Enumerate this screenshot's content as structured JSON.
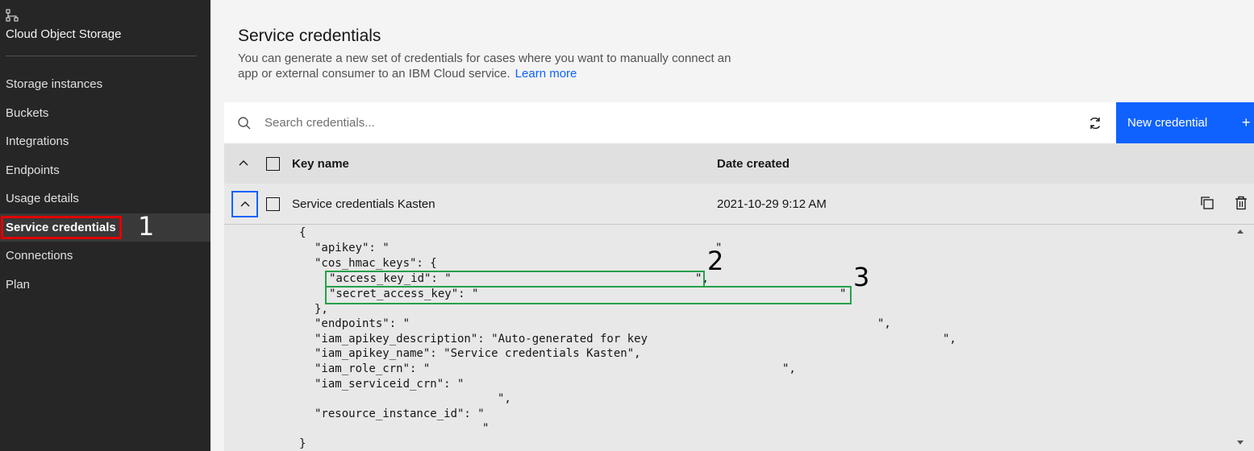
{
  "sidebar": {
    "icon": "hierarchy-icon",
    "title": "Cloud Object Storage",
    "items": [
      {
        "label": "Storage instances"
      },
      {
        "label": "Buckets"
      },
      {
        "label": "Integrations"
      },
      {
        "label": "Endpoints"
      },
      {
        "label": "Usage details"
      },
      {
        "label": "Service credentials",
        "active": true
      },
      {
        "label": "Connections"
      },
      {
        "label": "Plan"
      }
    ]
  },
  "annotations": {
    "one": "1",
    "two": "2",
    "three": "3"
  },
  "page": {
    "title": "Service credentials",
    "description": "You can generate a new set of credentials for cases where you want to manually connect an app or external consumer to an IBM Cloud service.",
    "learn_more": "Learn more"
  },
  "toolbar": {
    "search_placeholder": "Search credentials...",
    "new_credential": "New credential",
    "plus": "+"
  },
  "table": {
    "headers": {
      "key_name": "Key name",
      "date_created": "Date created"
    },
    "rows": [
      {
        "key_name": "Service credentials Kasten",
        "date_created": "2021-10-29 9:12 AM",
        "expanded": true
      }
    ]
  },
  "json_view": {
    "open_brace": "{",
    "apikey": "\"apikey\": \"",
    "apikey_end": "\"",
    "cos_hmac_keys": "\"cos_hmac_keys\": {",
    "access_key_id": "\"access_key_id\": \"",
    "access_key_id_end": "\",",
    "secret_access_key": "\"secret_access_key\": \"",
    "secret_access_key_end": "\"",
    "close_inner": "},",
    "endpoints": "\"endpoints\": \"",
    "endpoints_end": "\",",
    "iam_apikey_description": "\"iam_apikey_description\": \"Auto-generated for key",
    "iam_apikey_description_end": "\",",
    "iam_apikey_name": "\"iam_apikey_name\": \"Service credentials Kasten\",",
    "iam_role_crn": "\"iam_role_crn\": \"",
    "iam_role_crn_end": "\",",
    "iam_serviceid_crn": "\"iam_serviceid_crn\": \"",
    "iam_serviceid_crn_end": "\",",
    "resource_instance_id": "\"resource_instance_id\": \"",
    "resource_instance_id_end": "\"",
    "close_outer": "}"
  },
  "colors": {
    "accent": "#0f62fe",
    "sidebar_bg": "#262626",
    "highlight_red": "#e00000",
    "highlight_green": "#24a148"
  }
}
